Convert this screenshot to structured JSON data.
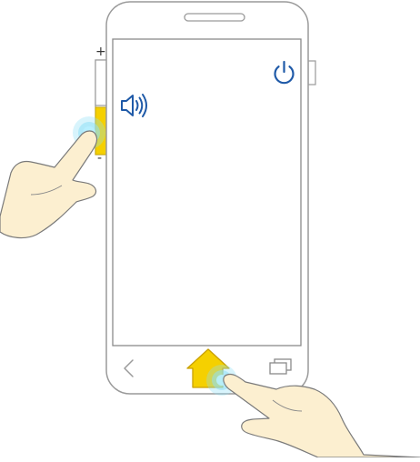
{
  "diagram": {
    "caption_hint": "",
    "volume_buttons": {
      "plus_label": "+",
      "minus_label": "-",
      "highlighted": "volume-down"
    },
    "screen_icons": [
      "power-icon",
      "speaker-volume-icon"
    ],
    "nav_bar": {
      "buttons": [
        "back-button",
        "home-button",
        "recent-apps-button"
      ],
      "highlighted": "home-button"
    },
    "gestures": [
      {
        "target": "volume-down-key",
        "action": "press"
      },
      {
        "target": "home-button",
        "action": "press"
      }
    ],
    "colors": {
      "phone_outline": "#9a9a9a",
      "highlight": "#f5d000",
      "icon_blue": "#1f5aa8",
      "touch_ripple": "#8fe0f5",
      "hand_skin": "#fcefd0",
      "hand_outline": "#7a7a7a"
    }
  }
}
